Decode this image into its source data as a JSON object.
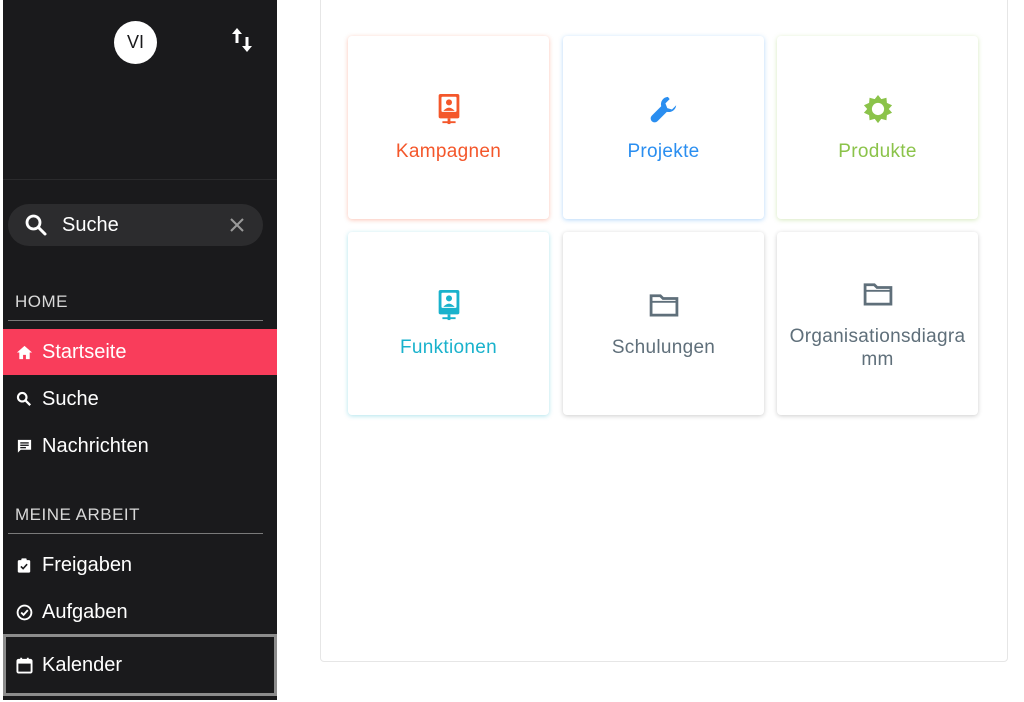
{
  "user": {
    "initials": "VI"
  },
  "search": {
    "placeholder": "Suche"
  },
  "sections": {
    "home": "HOME",
    "work": "MEINE ARBEIT"
  },
  "nav": {
    "startseite": "Startseite",
    "suche": "Suche",
    "nachrichten": "Nachrichten",
    "freigaben": "Freigaben",
    "aufgaben": "Aufgaben",
    "kalender": "Kalender"
  },
  "tiles": [
    {
      "label": "Kampagnen",
      "color": "#f4572b",
      "icon": "badge-icon"
    },
    {
      "label": "Projekte",
      "color": "#2a8ef0",
      "icon": "wrench-icon"
    },
    {
      "label": "Produkte",
      "color": "#8bc34a",
      "icon": "gear-icon"
    },
    {
      "label": "Funktionen",
      "color": "#19b2cc",
      "icon": "badge-icon"
    },
    {
      "label": "Schulungen",
      "color": "#5f6f7a",
      "icon": "folder-icon"
    },
    {
      "label": "Organisationsdiagramm",
      "color": "#5f6f7a",
      "icon": "folder-icon"
    }
  ],
  "colors": {
    "sidebar": "#1a1a1c",
    "active": "#f93d5b"
  }
}
